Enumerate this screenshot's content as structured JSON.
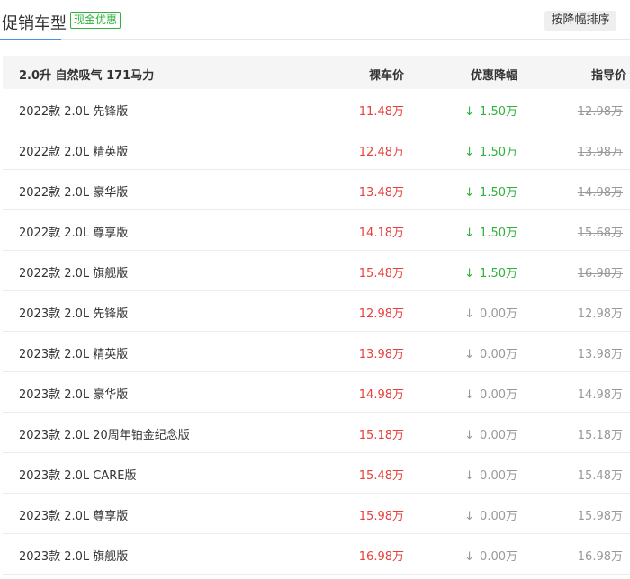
{
  "header": {
    "title": "促销车型",
    "badge": "现金优惠",
    "sort_button": "按降幅排序"
  },
  "table": {
    "group_label": "2.0升 自然吸气 171马力",
    "columns": {
      "price": "裸车价",
      "discount": "优惠降幅",
      "guide": "指导价"
    },
    "colors": {
      "price": "#e8413c",
      "discount_active": "#2fb13c",
      "discount_zero": "#999999"
    },
    "rows": [
      {
        "name": "2022款 2.0L 先锋版",
        "price": "11.48万",
        "arrow": "↓",
        "discount": "1.50万",
        "guide": "12.98万",
        "has_discount": true
      },
      {
        "name": "2022款 2.0L 精英版",
        "price": "12.48万",
        "arrow": "↓",
        "discount": "1.50万",
        "guide": "13.98万",
        "has_discount": true
      },
      {
        "name": "2022款 2.0L 豪华版",
        "price": "13.48万",
        "arrow": "↓",
        "discount": "1.50万",
        "guide": "14.98万",
        "has_discount": true
      },
      {
        "name": "2022款 2.0L 尊享版",
        "price": "14.18万",
        "arrow": "↓",
        "discount": "1.50万",
        "guide": "15.68万",
        "has_discount": true
      },
      {
        "name": "2022款 2.0L 旗舰版",
        "price": "15.48万",
        "arrow": "↓",
        "discount": "1.50万",
        "guide": "16.98万",
        "has_discount": true
      },
      {
        "name": "2023款 2.0L 先锋版",
        "price": "12.98万",
        "arrow": "↓",
        "discount": "0.00万",
        "guide": "12.98万",
        "has_discount": false
      },
      {
        "name": "2023款 2.0L 精英版",
        "price": "13.98万",
        "arrow": "↓",
        "discount": "0.00万",
        "guide": "13.98万",
        "has_discount": false
      },
      {
        "name": "2023款 2.0L 豪华版",
        "price": "14.98万",
        "arrow": "↓",
        "discount": "0.00万",
        "guide": "14.98万",
        "has_discount": false
      },
      {
        "name": "2023款 2.0L 20周年铂金纪念版",
        "price": "15.18万",
        "arrow": "↓",
        "discount": "0.00万",
        "guide": "15.18万",
        "has_discount": false
      },
      {
        "name": "2023款 2.0L CARE版",
        "price": "15.48万",
        "arrow": "↓",
        "discount": "0.00万",
        "guide": "15.48万",
        "has_discount": false
      },
      {
        "name": "2023款 2.0L 尊享版",
        "price": "15.98万",
        "arrow": "↓",
        "discount": "0.00万",
        "guide": "15.98万",
        "has_discount": false
      },
      {
        "name": "2023款 2.0L 旗舰版",
        "price": "16.98万",
        "arrow": "↓",
        "discount": "0.00万",
        "guide": "16.98万",
        "has_discount": false
      }
    ]
  }
}
